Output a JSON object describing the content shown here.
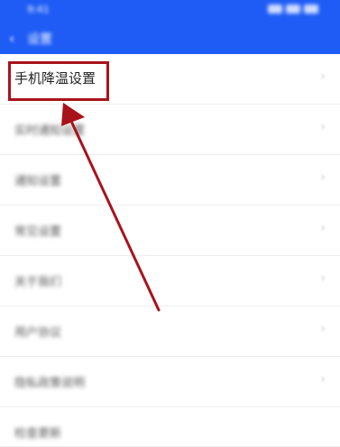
{
  "status_bar": {
    "time": "9:41",
    "icons": [
      "signal-icon",
      "wifi-icon",
      "battery-icon"
    ]
  },
  "header": {
    "back_icon": "‹",
    "title": "设置"
  },
  "settings": {
    "items": [
      {
        "label": "手机降温设置"
      },
      {
        "label": "实时通知设置"
      },
      {
        "label": "通知设置"
      },
      {
        "label": "常见设置"
      },
      {
        "label": "关于我们"
      },
      {
        "label": "用户协议"
      },
      {
        "label": "隐私政策说明"
      },
      {
        "label": "检查更新"
      }
    ]
  },
  "annotation": {
    "color": "#a8131b"
  },
  "colors": {
    "header": "#1e5cf5",
    "accent": "#a8131b"
  }
}
